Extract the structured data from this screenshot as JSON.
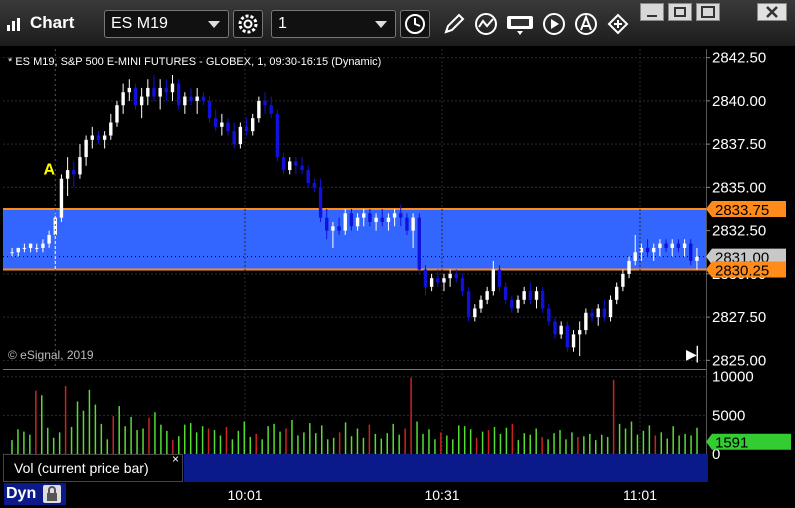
{
  "window": {
    "title": "Chart",
    "symbol": "ES M19",
    "interval": "1"
  },
  "header": {
    "description": "* ES M19, S&P 500 E-MINI FUTURES - GLOBEX, 1, 09:30-16:15 (Dynamic)"
  },
  "copyright": "© eSignal, 2019",
  "volume_study": {
    "label": "Vol (current price bar)",
    "close_glyph": "×"
  },
  "status": {
    "mode": "Dyn"
  },
  "icons": [
    "chart-app-icon",
    "settings-icon",
    "clock-icon",
    "pencil-icon",
    "study-icon",
    "get-icon",
    "play-icon",
    "alert-icon",
    "link-icon",
    "minimize-icon",
    "restore-icon",
    "maximize-icon",
    "close-icon",
    "scroll-end-icon",
    "lock-icon"
  ],
  "colors": {
    "up": "#ffffff",
    "down": "#1111dd",
    "zone": "#3366ff",
    "zone_border": "#ff8c1a",
    "vol_up": "#55dd33",
    "vol_down": "#cc2222",
    "current_price_bg": "#c8c8c8",
    "volume_badge_bg": "#33cc33"
  },
  "chart_data": [
    {
      "type": "candlestick",
      "title": "",
      "x_ticks": [
        "10:01",
        "10:31",
        "11:01"
      ],
      "y_ticks": [
        "2842.50",
        "2840.00",
        "2837.50",
        "2835.00",
        "2832.50",
        "2830.00",
        "2827.50",
        "2825.00"
      ],
      "ylim": [
        2824.5,
        2843.0
      ],
      "grid": true,
      "annotations": [
        {
          "text": "A",
          "color": "#ffff00",
          "price": 2835.75
        }
      ],
      "zone": {
        "top": 2833.75,
        "bottom": 2830.25,
        "top_label": "2833.75",
        "bottom_label": "2830.25"
      },
      "current_price": {
        "value": 2831.0,
        "label": "2831.00"
      },
      "candles": [
        [
          2831.25,
          2831.5,
          2831.0,
          2831.25
        ],
        [
          2831.25,
          2831.5,
          2831.0,
          2831.5
        ],
        [
          2831.5,
          2831.75,
          2831.25,
          2831.5
        ],
        [
          2831.5,
          2831.75,
          2831.25,
          2831.75
        ],
        [
          2831.5,
          2831.75,
          2831.25,
          2831.5
        ],
        [
          2831.5,
          2832.0,
          2831.25,
          2831.75
        ],
        [
          2831.75,
          2832.5,
          2831.5,
          2832.25
        ],
        [
          2832.25,
          2833.5,
          2830.25,
          2833.25
        ],
        [
          2833.25,
          2835.75,
          2833.0,
          2835.5
        ],
        [
          2835.5,
          2836.75,
          2834.5,
          2836.0
        ],
        [
          2836.0,
          2836.5,
          2835.0,
          2835.75
        ],
        [
          2835.75,
          2837.5,
          2835.5,
          2836.75
        ],
        [
          2836.75,
          2838.0,
          2836.25,
          2837.75
        ],
        [
          2837.75,
          2838.5,
          2837.25,
          2838.0
        ],
        [
          2838.0,
          2838.25,
          2837.5,
          2837.75
        ],
        [
          2837.75,
          2838.25,
          2837.25,
          2838.0
        ],
        [
          2838.0,
          2839.25,
          2837.75,
          2838.75
        ],
        [
          2838.75,
          2840.0,
          2838.5,
          2839.75
        ],
        [
          2839.75,
          2841.0,
          2839.25,
          2840.5
        ],
        [
          2840.5,
          2841.25,
          2840.0,
          2840.75
        ],
        [
          2840.75,
          2841.0,
          2839.5,
          2839.75
        ],
        [
          2839.75,
          2840.75,
          2839.0,
          2840.25
        ],
        [
          2840.25,
          2841.25,
          2839.75,
          2840.75
        ],
        [
          2840.75,
          2841.5,
          2840.0,
          2840.25
        ],
        [
          2840.25,
          2841.25,
          2839.5,
          2840.75
        ],
        [
          2840.75,
          2841.25,
          2840.0,
          2840.5
        ],
        [
          2840.5,
          2841.5,
          2840.0,
          2841.0
        ],
        [
          2841.0,
          2841.25,
          2839.5,
          2839.75
        ],
        [
          2839.75,
          2840.5,
          2839.25,
          2840.25
        ],
        [
          2840.25,
          2840.75,
          2839.75,
          2840.0
        ],
        [
          2840.0,
          2840.75,
          2839.25,
          2840.25
        ],
        [
          2840.25,
          2840.5,
          2839.75,
          2840.0
        ],
        [
          2840.0,
          2840.25,
          2838.75,
          2839.0
        ],
        [
          2839.0,
          2839.5,
          2838.25,
          2838.5
        ],
        [
          2838.5,
          2839.25,
          2838.0,
          2838.75
        ],
        [
          2838.75,
          2839.0,
          2838.0,
          2838.25
        ],
        [
          2838.25,
          2838.75,
          2837.25,
          2837.5
        ],
        [
          2837.5,
          2838.75,
          2837.25,
          2838.5
        ],
        [
          2838.5,
          2839.0,
          2838.0,
          2838.25
        ],
        [
          2838.25,
          2839.25,
          2838.0,
          2839.0
        ],
        [
          2839.0,
          2840.25,
          2838.75,
          2840.0
        ],
        [
          2840.0,
          2840.5,
          2839.25,
          2839.75
        ],
        [
          2839.75,
          2840.25,
          2839.0,
          2839.25
        ],
        [
          2839.25,
          2839.5,
          2836.5,
          2836.75
        ],
        [
          2836.75,
          2837.0,
          2835.75,
          2836.0
        ],
        [
          2836.0,
          2836.75,
          2835.75,
          2836.5
        ],
        [
          2836.5,
          2836.75,
          2835.75,
          2836.25
        ],
        [
          2836.25,
          2836.75,
          2835.75,
          2836.0
        ],
        [
          2836.0,
          2836.25,
          2835.0,
          2835.25
        ],
        [
          2835.25,
          2835.5,
          2834.75,
          2835.0
        ],
        [
          2835.0,
          2835.5,
          2833.0,
          2833.25
        ],
        [
          2833.25,
          2833.75,
          2832.0,
          2832.5
        ],
        [
          2832.5,
          2833.0,
          2831.5,
          2832.75
        ],
        [
          2832.75,
          2833.25,
          2832.25,
          2832.5
        ],
        [
          2832.5,
          2833.75,
          2832.25,
          2833.5
        ],
        [
          2833.5,
          2833.75,
          2832.5,
          2832.75
        ],
        [
          2832.75,
          2833.5,
          2832.5,
          2833.25
        ],
        [
          2833.25,
          2833.75,
          2832.75,
          2833.5
        ],
        [
          2833.5,
          2833.75,
          2832.75,
          2833.0
        ],
        [
          2833.0,
          2833.5,
          2832.5,
          2833.25
        ],
        [
          2833.25,
          2833.75,
          2832.75,
          2833.0
        ],
        [
          2833.0,
          2833.5,
          2832.5,
          2833.25
        ],
        [
          2833.25,
          2833.75,
          2832.75,
          2833.5
        ],
        [
          2833.5,
          2834.0,
          2832.75,
          2833.25
        ],
        [
          2833.25,
          2833.5,
          2832.25,
          2832.5
        ],
        [
          2832.5,
          2833.5,
          2831.5,
          2833.25
        ],
        [
          2833.25,
          2833.5,
          2830.0,
          2830.25
        ],
        [
          2830.25,
          2830.5,
          2828.75,
          2829.25
        ],
        [
          2829.25,
          2830.0,
          2829.0,
          2829.75
        ],
        [
          2829.75,
          2830.25,
          2829.25,
          2829.5
        ],
        [
          2829.5,
          2830.0,
          2829.0,
          2829.75
        ],
        [
          2829.75,
          2830.25,
          2829.25,
          2830.0
        ],
        [
          2830.0,
          2830.25,
          2829.5,
          2829.75
        ],
        [
          2829.75,
          2830.0,
          2828.75,
          2829.0
        ],
        [
          2829.0,
          2829.25,
          2827.25,
          2827.5
        ],
        [
          2827.5,
          2828.25,
          2827.25,
          2828.0
        ],
        [
          2828.0,
          2828.75,
          2827.75,
          2828.5
        ],
        [
          2828.5,
          2829.25,
          2828.25,
          2829.0
        ],
        [
          2829.0,
          2830.75,
          2828.75,
          2830.25
        ],
        [
          2830.25,
          2830.5,
          2829.0,
          2829.25
        ],
        [
          2829.25,
          2829.5,
          2828.25,
          2828.5
        ],
        [
          2828.5,
          2828.75,
          2827.75,
          2828.0
        ],
        [
          2828.0,
          2828.75,
          2827.75,
          2828.5
        ],
        [
          2828.5,
          2829.25,
          2828.25,
          2829.0
        ],
        [
          2829.0,
          2829.5,
          2828.25,
          2828.5
        ],
        [
          2828.5,
          2829.25,
          2828.0,
          2829.0
        ],
        [
          2829.0,
          2829.25,
          2827.75,
          2828.0
        ],
        [
          2828.0,
          2828.25,
          2827.0,
          2827.25
        ],
        [
          2827.25,
          2827.5,
          2826.25,
          2826.5
        ],
        [
          2826.5,
          2827.25,
          2826.25,
          2827.0
        ],
        [
          2827.0,
          2827.25,
          2825.5,
          2825.75
        ],
        [
          2825.75,
          2826.75,
          2825.5,
          2826.5
        ],
        [
          2826.5,
          2827.25,
          2825.25,
          2826.75
        ],
        [
          2826.75,
          2828.0,
          2826.5,
          2827.75
        ],
        [
          2827.75,
          2828.0,
          2827.25,
          2827.5
        ],
        [
          2827.5,
          2828.25,
          2827.0,
          2828.0
        ],
        [
          2828.0,
          2828.5,
          2827.25,
          2827.5
        ],
        [
          2827.5,
          2828.75,
          2827.25,
          2828.5
        ],
        [
          2828.5,
          2829.5,
          2828.25,
          2829.25
        ],
        [
          2829.25,
          2830.25,
          2829.0,
          2830.0
        ],
        [
          2830.0,
          2831.0,
          2829.75,
          2830.75
        ],
        [
          2830.75,
          2832.25,
          2830.5,
          2831.25
        ],
        [
          2831.25,
          2831.75,
          2830.75,
          2831.5
        ],
        [
          2831.5,
          2832.0,
          2831.0,
          2831.25
        ],
        [
          2831.25,
          2831.75,
          2830.75,
          2831.5
        ],
        [
          2831.5,
          2832.0,
          2831.0,
          2831.75
        ],
        [
          2831.75,
          2832.0,
          2831.25,
          2831.5
        ],
        [
          2831.5,
          2832.0,
          2831.0,
          2831.75
        ],
        [
          2831.75,
          2832.0,
          2831.25,
          2831.5
        ],
        [
          2831.5,
          2832.0,
          2831.0,
          2831.75
        ],
        [
          2831.75,
          2832.0,
          2830.5,
          2830.75
        ],
        [
          2830.75,
          2831.5,
          2830.25,
          2831.0
        ]
      ]
    },
    {
      "type": "bar",
      "title": "Vol (current price bar)",
      "y_ticks": [
        "10000",
        "5000",
        "0"
      ],
      "ylim": [
        0,
        11000
      ],
      "current_value": 1591,
      "current_label": "1591",
      "values": [
        1800,
        3200,
        2900,
        2500,
        8200,
        7600,
        3400,
        2100,
        2800,
        8800,
        3500,
        6800,
        5600,
        8300,
        6400,
        3900,
        1900,
        4900,
        6200,
        3600,
        4800,
        3100,
        3300,
        4700,
        5400,
        3800,
        3000,
        1800,
        2300,
        3800,
        4000,
        2800,
        3600,
        3300,
        3100,
        2400,
        3500,
        1900,
        3000,
        4200,
        2200,
        2600,
        1900,
        3600,
        3900,
        2900,
        3300,
        4400,
        2400,
        2800,
        4000,
        2700,
        3700,
        1900,
        2100,
        2800,
        4100,
        2300,
        3300,
        2100,
        3800,
        2600,
        2000,
        2700,
        3900,
        2500,
        3300,
        9900,
        4200,
        2600,
        3200,
        1900,
        2800,
        2400,
        1900,
        3700,
        3600,
        3200,
        2100,
        2900,
        3100,
        3500,
        2600,
        3400,
        3900,
        1800,
        2700,
        2500,
        3300,
        2200,
        1900,
        2700,
        3100,
        1900,
        2800,
        2200,
        2300,
        2600,
        1800,
        2500,
        2200,
        9600,
        3900,
        3300,
        4200,
        2500,
        3000,
        3700,
        2400,
        2800,
        2000,
        3600,
        2400,
        2600,
        2400,
        3400
      ],
      "down_bars": [
        4,
        9,
        17,
        23,
        27,
        33,
        36,
        41,
        46,
        55,
        60,
        66,
        67,
        72,
        78,
        80,
        84,
        89,
        95,
        101,
        108
      ]
    }
  ]
}
